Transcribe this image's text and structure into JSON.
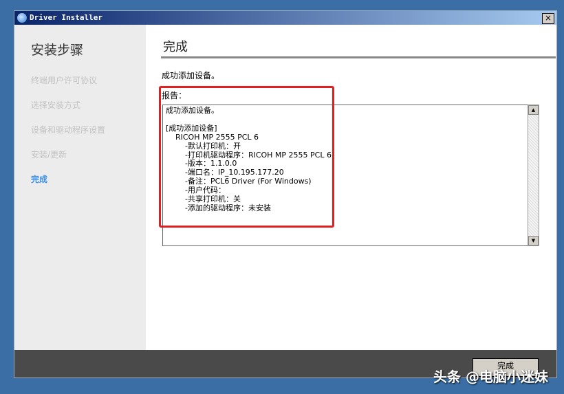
{
  "window": {
    "title": "Driver Installer",
    "close": "×"
  },
  "sidebar": {
    "title": "安装步骤",
    "items": [
      {
        "label": "终端用户许可协议"
      },
      {
        "label": "选择安装方式"
      },
      {
        "label": "设备和驱动程序设置"
      },
      {
        "label": "安装/更新"
      },
      {
        "label": "完成"
      }
    ]
  },
  "main": {
    "title": "完成",
    "message": "成功添加设备。",
    "report_label": "报告：",
    "report_text": "成功添加设备。\n\n[成功添加设备]\n    RICOH MP 2555 PCL 6\n        -默认打印机：开\n        -打印机驱动程序：RICOH MP 2555 PCL 6\n        -版本：1.1.0.0\n        -端口名：IP_10.195.177.20\n        -备注：PCL6 Driver (For Windows)\n        -用户代码：\n        -共享打印机：关\n        -添加的驱动程序：未安装"
  },
  "footer": {
    "finish_label": "完成"
  },
  "watermark": "头条 @电脑小迷妹"
}
